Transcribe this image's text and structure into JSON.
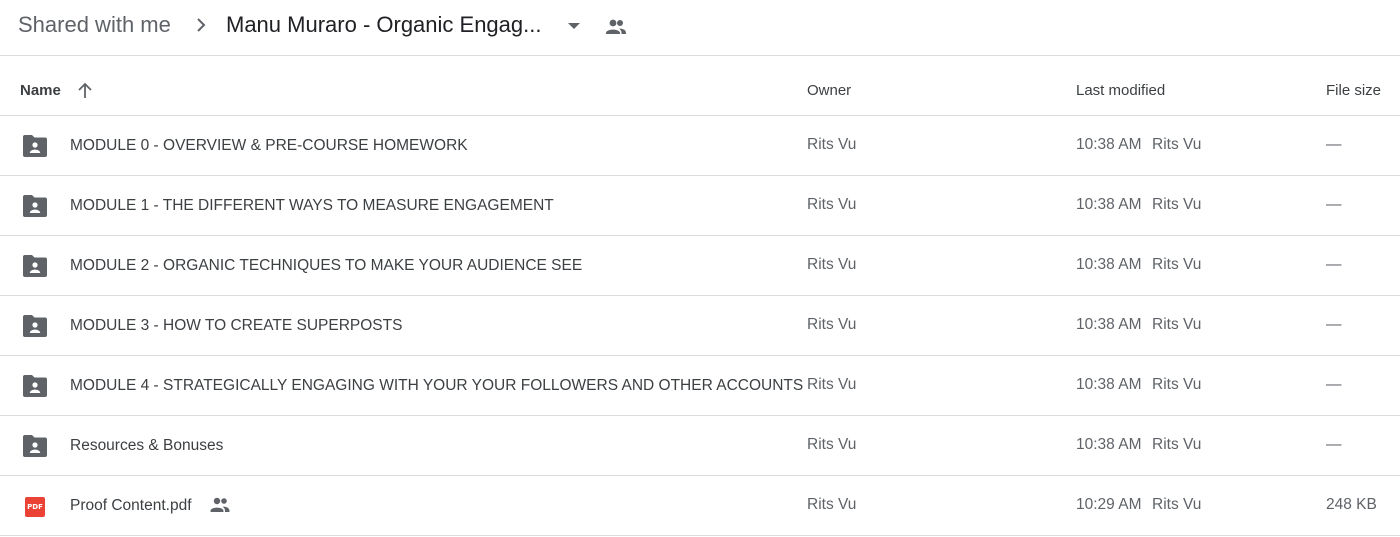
{
  "breadcrumb": {
    "root": "Shared with me",
    "current": "Manu Muraro - Organic Engag...",
    "separator_icon": "chevron-right-icon",
    "caret_icon": "arrow-drop-down-icon",
    "shared_icon": "people-icon"
  },
  "columns": {
    "name": "Name",
    "owner": "Owner",
    "last_modified": "Last modified",
    "file_size": "File size",
    "sort_icon": "arrow-upward-icon"
  },
  "files": [
    {
      "type": "shared-folder",
      "name": "MODULE 0 - OVERVIEW & PRE-COURSE HOMEWORK",
      "owner": "Rits Vu",
      "modified_time": "10:38 AM",
      "modified_by": "Rits Vu",
      "size": "—"
    },
    {
      "type": "shared-folder",
      "name": "MODULE 1 - THE DIFFERENT WAYS TO MEASURE ENGAGEMENT",
      "owner": "Rits Vu",
      "modified_time": "10:38 AM",
      "modified_by": "Rits Vu",
      "size": "—"
    },
    {
      "type": "shared-folder",
      "name": "MODULE 2 - ORGANIC TECHNIQUES TO MAKE YOUR AUDIENCE SEE",
      "owner": "Rits Vu",
      "modified_time": "10:38 AM",
      "modified_by": "Rits Vu",
      "size": "—"
    },
    {
      "type": "shared-folder",
      "name": "MODULE 3 - HOW TO CREATE SUPERPOSTS",
      "owner": "Rits Vu",
      "modified_time": "10:38 AM",
      "modified_by": "Rits Vu",
      "size": "—"
    },
    {
      "type": "shared-folder",
      "name": "MODULE 4 - STRATEGICALLY ENGAGING WITH YOUR YOUR FOLLOWERS AND OTHER ACCOUNTS",
      "owner": "Rits Vu",
      "modified_time": "10:38 AM",
      "modified_by": "Rits Vu",
      "size": "—"
    },
    {
      "type": "shared-folder",
      "name": "Resources & Bonuses",
      "owner": "Rits Vu",
      "modified_time": "10:38 AM",
      "modified_by": "Rits Vu",
      "size": "—"
    },
    {
      "type": "pdf",
      "name": "Proof Content.pdf",
      "badge": "PDF",
      "shared": true,
      "owner": "Rits Vu",
      "modified_time": "10:29 AM",
      "modified_by": "Rits Vu",
      "size": "248 KB"
    }
  ],
  "colors": {
    "text_primary": "#3c4043",
    "text_secondary": "#5f6368",
    "divider": "#dadce0",
    "folder_icon": "#5f6368",
    "pdf_red": "#ea4335"
  }
}
